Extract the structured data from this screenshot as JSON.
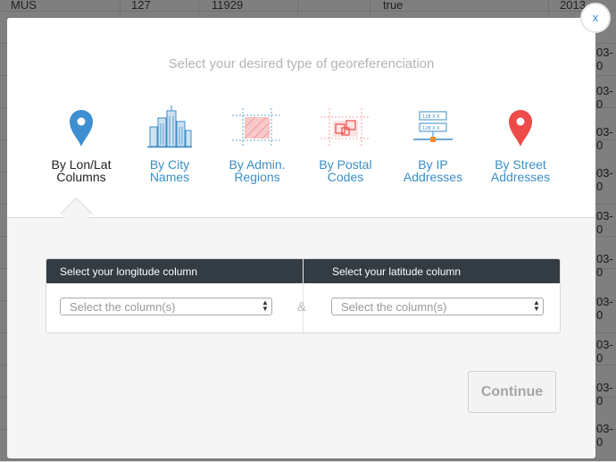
{
  "background_table": {
    "visible_row": [
      "MUS",
      "127",
      "11929",
      "",
      "true",
      "2013-"
    ],
    "date_fragment": "03-0"
  },
  "modal": {
    "title": "Select your desired type of georeferenciation",
    "close_label": "x",
    "options": [
      {
        "label_line1": "By Lon/Lat",
        "label_line2": "Columns",
        "icon": "map-pin-icon",
        "selected": true
      },
      {
        "label_line1": "By City",
        "label_line2": "Names",
        "icon": "city-buildings-icon",
        "selected": false
      },
      {
        "label_line1": "By Admin.",
        "label_line2": "Regions",
        "icon": "admin-region-icon",
        "selected": false
      },
      {
        "label_line1": "By Postal",
        "label_line2": "Codes",
        "icon": "postal-codes-icon",
        "selected": false
      },
      {
        "label_line1": "By IP",
        "label_line2": "Addresses",
        "icon": "ip-address-icon",
        "selected": false
      },
      {
        "label_line1": "By Street",
        "label_line2": "Addresses",
        "icon": "street-pin-icon",
        "selected": false
      }
    ],
    "longitude": {
      "header": "Select your longitude column",
      "placeholder": "Select the column(s)"
    },
    "latitude": {
      "header": "Select your latitude column",
      "placeholder": "Select the column(s)"
    },
    "separator": "&",
    "continue_label": "Continue"
  },
  "colors": {
    "accent": "#3a8ec7",
    "pin_blue": "#3d8fd1",
    "pin_red": "#ef4a4a",
    "panel_header": "#333c42"
  }
}
